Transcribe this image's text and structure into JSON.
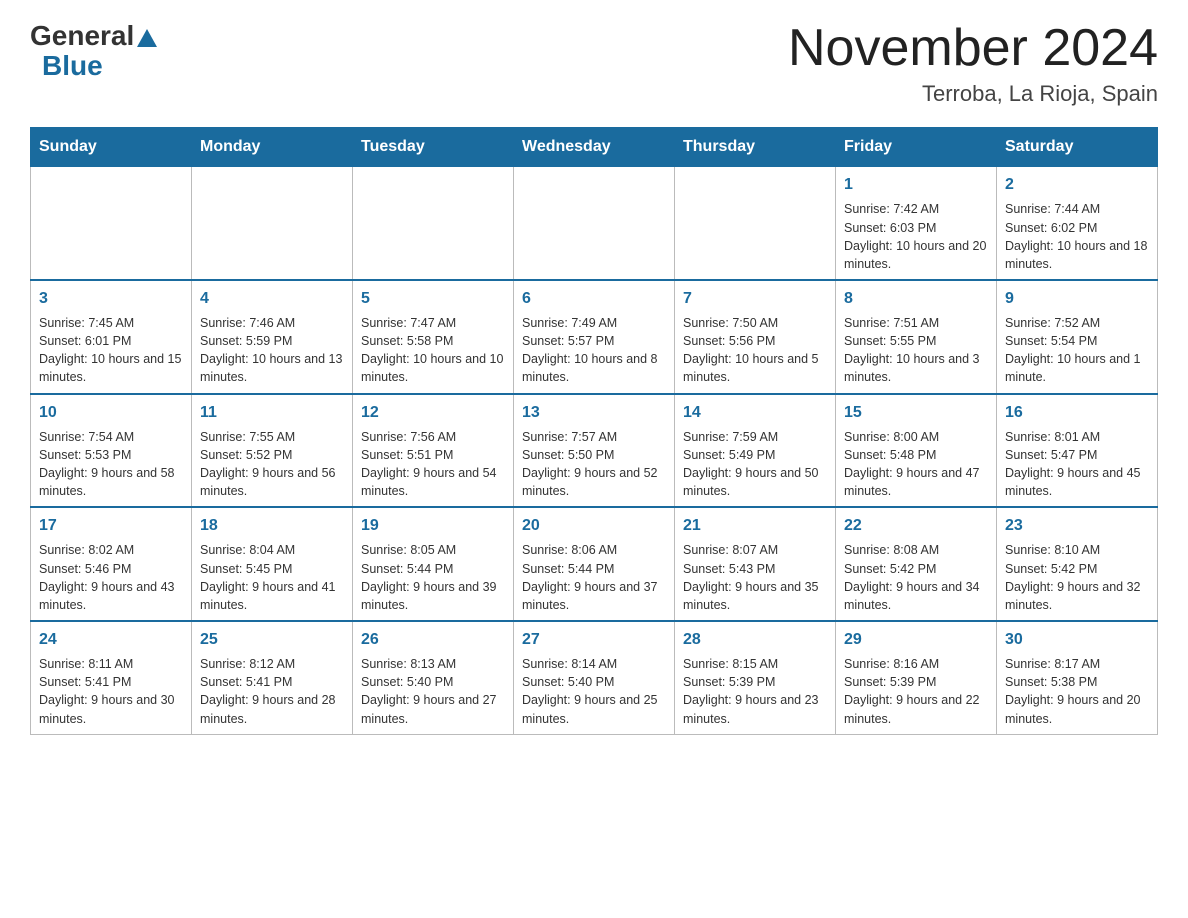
{
  "header": {
    "logo": {
      "general": "General",
      "blue": "Blue",
      "triangle": "▲"
    },
    "title": "November 2024",
    "subtitle": "Terroba, La Rioja, Spain"
  },
  "calendar": {
    "days_of_week": [
      "Sunday",
      "Monday",
      "Tuesday",
      "Wednesday",
      "Thursday",
      "Friday",
      "Saturday"
    ],
    "weeks": [
      {
        "days": [
          {
            "number": "",
            "info": ""
          },
          {
            "number": "",
            "info": ""
          },
          {
            "number": "",
            "info": ""
          },
          {
            "number": "",
            "info": ""
          },
          {
            "number": "",
            "info": ""
          },
          {
            "number": "1",
            "info": "Sunrise: 7:42 AM\nSunset: 6:03 PM\nDaylight: 10 hours and 20 minutes."
          },
          {
            "number": "2",
            "info": "Sunrise: 7:44 AM\nSunset: 6:02 PM\nDaylight: 10 hours and 18 minutes."
          }
        ]
      },
      {
        "days": [
          {
            "number": "3",
            "info": "Sunrise: 7:45 AM\nSunset: 6:01 PM\nDaylight: 10 hours and 15 minutes."
          },
          {
            "number": "4",
            "info": "Sunrise: 7:46 AM\nSunset: 5:59 PM\nDaylight: 10 hours and 13 minutes."
          },
          {
            "number": "5",
            "info": "Sunrise: 7:47 AM\nSunset: 5:58 PM\nDaylight: 10 hours and 10 minutes."
          },
          {
            "number": "6",
            "info": "Sunrise: 7:49 AM\nSunset: 5:57 PM\nDaylight: 10 hours and 8 minutes."
          },
          {
            "number": "7",
            "info": "Sunrise: 7:50 AM\nSunset: 5:56 PM\nDaylight: 10 hours and 5 minutes."
          },
          {
            "number": "8",
            "info": "Sunrise: 7:51 AM\nSunset: 5:55 PM\nDaylight: 10 hours and 3 minutes."
          },
          {
            "number": "9",
            "info": "Sunrise: 7:52 AM\nSunset: 5:54 PM\nDaylight: 10 hours and 1 minute."
          }
        ]
      },
      {
        "days": [
          {
            "number": "10",
            "info": "Sunrise: 7:54 AM\nSunset: 5:53 PM\nDaylight: 9 hours and 58 minutes."
          },
          {
            "number": "11",
            "info": "Sunrise: 7:55 AM\nSunset: 5:52 PM\nDaylight: 9 hours and 56 minutes."
          },
          {
            "number": "12",
            "info": "Sunrise: 7:56 AM\nSunset: 5:51 PM\nDaylight: 9 hours and 54 minutes."
          },
          {
            "number": "13",
            "info": "Sunrise: 7:57 AM\nSunset: 5:50 PM\nDaylight: 9 hours and 52 minutes."
          },
          {
            "number": "14",
            "info": "Sunrise: 7:59 AM\nSunset: 5:49 PM\nDaylight: 9 hours and 50 minutes."
          },
          {
            "number": "15",
            "info": "Sunrise: 8:00 AM\nSunset: 5:48 PM\nDaylight: 9 hours and 47 minutes."
          },
          {
            "number": "16",
            "info": "Sunrise: 8:01 AM\nSunset: 5:47 PM\nDaylight: 9 hours and 45 minutes."
          }
        ]
      },
      {
        "days": [
          {
            "number": "17",
            "info": "Sunrise: 8:02 AM\nSunset: 5:46 PM\nDaylight: 9 hours and 43 minutes."
          },
          {
            "number": "18",
            "info": "Sunrise: 8:04 AM\nSunset: 5:45 PM\nDaylight: 9 hours and 41 minutes."
          },
          {
            "number": "19",
            "info": "Sunrise: 8:05 AM\nSunset: 5:44 PM\nDaylight: 9 hours and 39 minutes."
          },
          {
            "number": "20",
            "info": "Sunrise: 8:06 AM\nSunset: 5:44 PM\nDaylight: 9 hours and 37 minutes."
          },
          {
            "number": "21",
            "info": "Sunrise: 8:07 AM\nSunset: 5:43 PM\nDaylight: 9 hours and 35 minutes."
          },
          {
            "number": "22",
            "info": "Sunrise: 8:08 AM\nSunset: 5:42 PM\nDaylight: 9 hours and 34 minutes."
          },
          {
            "number": "23",
            "info": "Sunrise: 8:10 AM\nSunset: 5:42 PM\nDaylight: 9 hours and 32 minutes."
          }
        ]
      },
      {
        "days": [
          {
            "number": "24",
            "info": "Sunrise: 8:11 AM\nSunset: 5:41 PM\nDaylight: 9 hours and 30 minutes."
          },
          {
            "number": "25",
            "info": "Sunrise: 8:12 AM\nSunset: 5:41 PM\nDaylight: 9 hours and 28 minutes."
          },
          {
            "number": "26",
            "info": "Sunrise: 8:13 AM\nSunset: 5:40 PM\nDaylight: 9 hours and 27 minutes."
          },
          {
            "number": "27",
            "info": "Sunrise: 8:14 AM\nSunset: 5:40 PM\nDaylight: 9 hours and 25 minutes."
          },
          {
            "number": "28",
            "info": "Sunrise: 8:15 AM\nSunset: 5:39 PM\nDaylight: 9 hours and 23 minutes."
          },
          {
            "number": "29",
            "info": "Sunrise: 8:16 AM\nSunset: 5:39 PM\nDaylight: 9 hours and 22 minutes."
          },
          {
            "number": "30",
            "info": "Sunrise: 8:17 AM\nSunset: 5:38 PM\nDaylight: 9 hours and 20 minutes."
          }
        ]
      }
    ]
  }
}
